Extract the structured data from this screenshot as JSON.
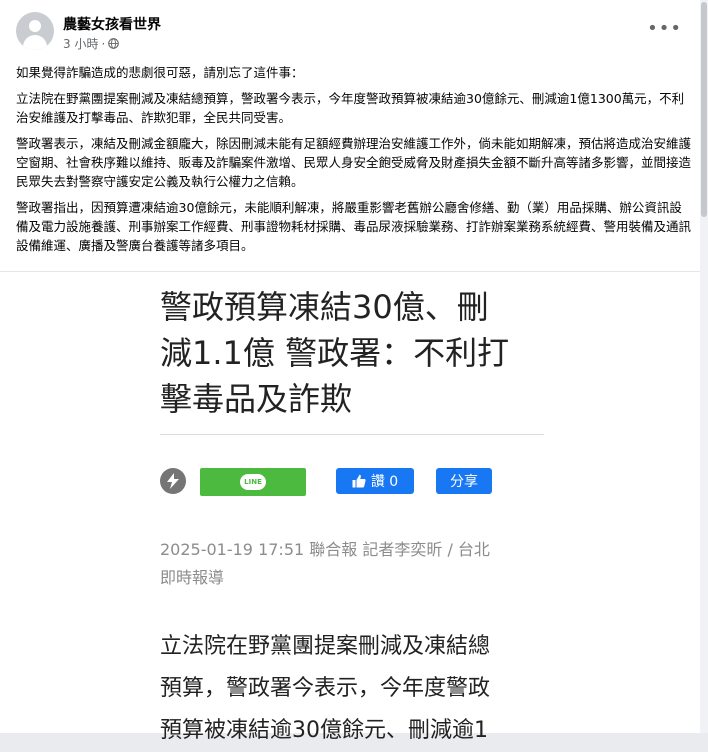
{
  "post": {
    "author": "農藝女孩看世界",
    "time": "3 小時",
    "more_icon": "more-horizontal-icon",
    "paragraphs": [
      "如果覺得詐騙造成的悲劇很可惡，請別忘了這件事：",
      "立法院在野黨團提案刪減及凍結總預算，警政署今表示，今年度警政預算被凍結逾30億餘元、刪減逾1億1300萬元，不利治安維護及打擊毒品、詐欺犯罪，全民共同受害。",
      "警政署表示，凍結及刪減金額龐大，除因刪減未能有足額經費辦理治安維護工作外，倘未能如期解凍，預估將造成治安維護空窗期、社會秩序難以維持、販毒及詐騙案件激增、民眾人身安全飽受威脅及財產損失金額不斷升高等諸多影響，並間接造民眾失去對警察守護安定公義及執行公權力之信賴。",
      "警政署指出，因預算遭凍結逾30億餘元，未能順利解凍，將嚴重影響老舊辦公廳舍修繕、勤（業）用品採購、辦公資訊設備及電力設施養護、刑事辦案工作經費、刑事證物耗材採購、毒品尿液採驗業務、打詐辦案業務系統經費、警用裝備及通訊設備維運、廣播及警廣台養護等諸多項目。"
    ]
  },
  "article": {
    "headline_lines": [
      "警政預算凍結30億、刪",
      "減1.1億 警政署：不利打",
      "擊毒品及詐欺"
    ],
    "line_label": "LINE",
    "like_label": "讚 0",
    "share_label": "分享",
    "byline_line1": "2025-01-19 17:51  聯合報 記者李奕昕 / 台北",
    "byline_line2": "即時報導",
    "lede_lines": [
      "立法院在野黨團提案刪減及凍結總",
      "預算，警政署今表示，今年度警政",
      "預算被凍結逾30億餘元、刪減逾1"
    ]
  },
  "colors": {
    "facebook_blue": "#1877f2",
    "line_green": "#4cba3f"
  }
}
